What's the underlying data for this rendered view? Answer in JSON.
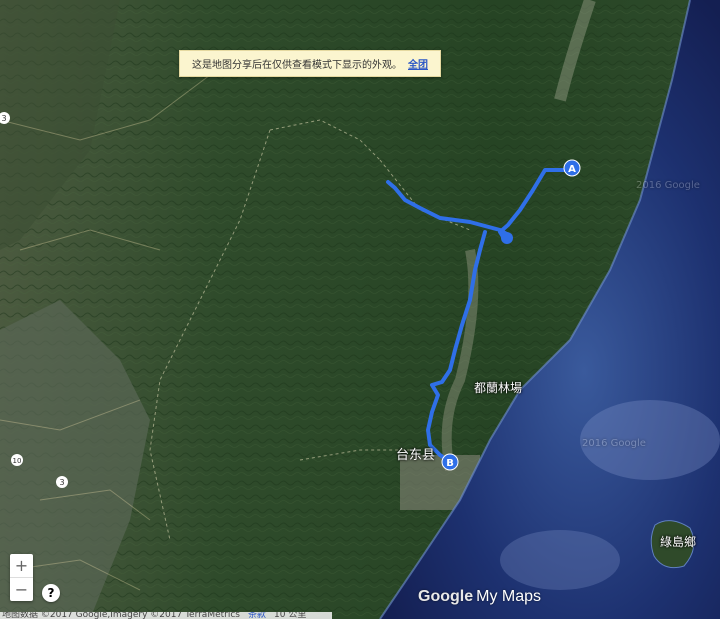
{
  "notice": {
    "text": "这是地图分享后在仅供查看模式下显示的外观。",
    "link": "全团"
  },
  "labels": {
    "forest": "都蘭林場",
    "city": "台东县",
    "island": "綠島鄉",
    "copyright_faint1": "2016 Google",
    "copyright_faint2": "2016 Google",
    "road3": "3",
    "road10": "10",
    "road3b": "3"
  },
  "markers": {
    "start": "A",
    "end": "B"
  },
  "controls": {
    "zoom_in": "+",
    "zoom_out": "−",
    "help": "?"
  },
  "branding": {
    "google": "Google",
    "mymaps": "My Maps"
  },
  "footer": {
    "data": "地图数据 ©2017 Google,Imagery ©2017 TerraMetrics",
    "terms": "条款",
    "scale": "10 公里"
  },
  "colors": {
    "route": "#2f6fe8",
    "marker": "#2f6fe8",
    "land": "#2b4a2a",
    "sea": "#1c2f6e"
  }
}
